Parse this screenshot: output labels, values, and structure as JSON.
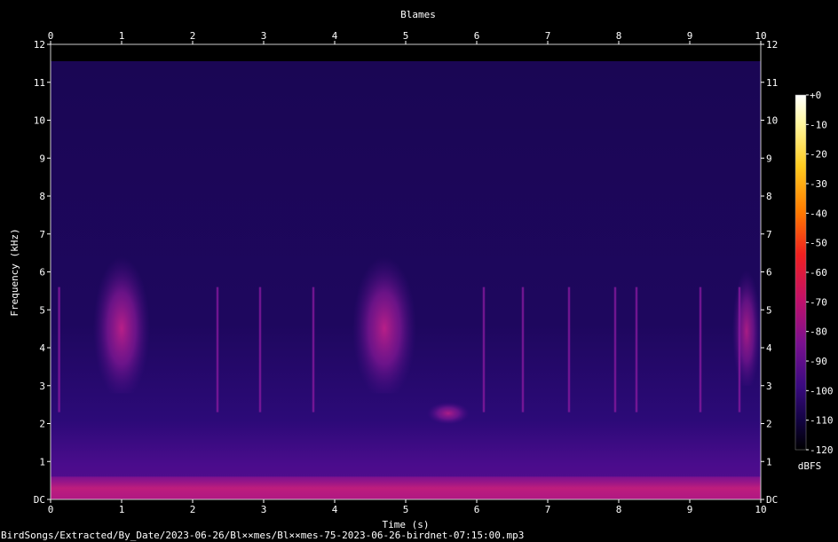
{
  "chart_data": {
    "type": "heatmap",
    "title": "Blames",
    "xlabel": "Time (s)",
    "ylabel": "Frequency (kHz)",
    "xlim": [
      0,
      10
    ],
    "ylim": [
      0,
      12
    ],
    "x_ticks": [
      "0",
      "1",
      "2",
      "3",
      "4",
      "5",
      "6",
      "7",
      "8",
      "9",
      "10"
    ],
    "y_ticks": [
      "DC",
      "1",
      "2",
      "3",
      "4",
      "5",
      "6",
      "7",
      "8",
      "9",
      "10",
      "11",
      "12"
    ],
    "colorbar": {
      "label": "dBFS",
      "ticks": [
        "+0",
        "-10",
        "-20",
        "-30",
        "-40",
        "-50",
        "-60",
        "-70",
        "-80",
        "-90",
        "-100",
        "-110",
        "-120"
      ],
      "range": [
        -120,
        0
      ]
    },
    "background_level_db": -105,
    "noise_ceiling_khz": 11.5,
    "events": [
      {
        "t0": 0.6,
        "t1": 1.4,
        "f0": 2.8,
        "f1": 6.6,
        "level_db": -80
      },
      {
        "t0": 4.25,
        "t1": 5.15,
        "f0": 2.8,
        "f1": 6.6,
        "level_db": -78
      },
      {
        "t0": 5.3,
        "t1": 5.9,
        "f0": 2.0,
        "f1": 2.6,
        "level_db": -88
      },
      {
        "t0": 9.6,
        "t1": 10.0,
        "f0": 3.0,
        "f1": 6.2,
        "level_db": -88
      },
      {
        "t0": 0.0,
        "t1": 10.0,
        "f0": 0.0,
        "f1": 0.6,
        "level_db": -72
      }
    ],
    "clicks_s": [
      0.12,
      2.35,
      2.95,
      3.7,
      6.1,
      6.65,
      7.3,
      7.95,
      8.25,
      9.15,
      9.7
    ]
  },
  "footer": {
    "filename": "BirdSongs/Extracted/By_Date/2023-06-26/Bl××mes/Bl××mes-75-2023-06-26-birdnet-07:15:00.mp3"
  },
  "colors": {
    "background": "#000000",
    "axis": "#ffffff",
    "palette": [
      "#ffffff",
      "#fff9a0",
      "#ffd020",
      "#ff8a00",
      "#ff3a10",
      "#e0104a",
      "#b0107a",
      "#7a1090",
      "#4a0c8a",
      "#24066a",
      "#0c0230",
      "#000000"
    ]
  }
}
